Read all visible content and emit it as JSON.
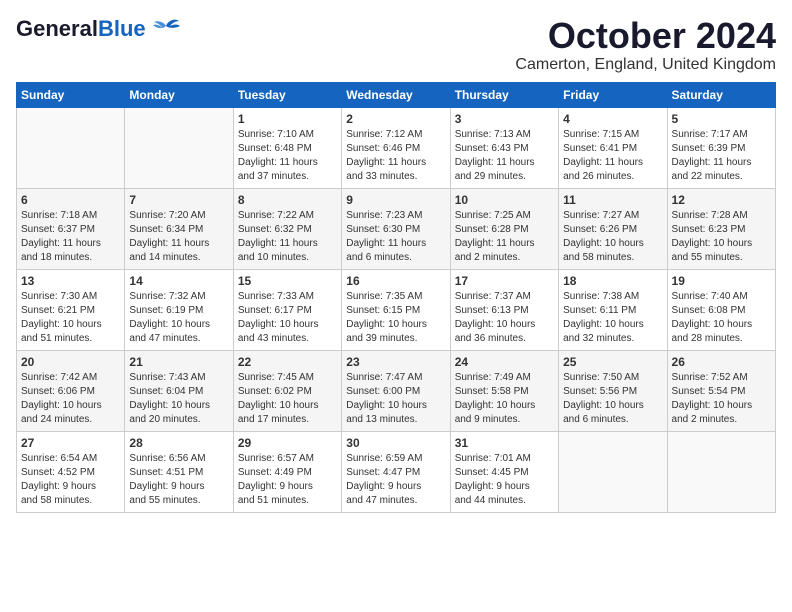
{
  "header": {
    "logo_general": "General",
    "logo_blue": "Blue",
    "month_title": "October 2024",
    "location": "Camerton, England, United Kingdom"
  },
  "weekdays": [
    "Sunday",
    "Monday",
    "Tuesday",
    "Wednesday",
    "Thursday",
    "Friday",
    "Saturday"
  ],
  "weeks": [
    [
      {
        "day": "",
        "info": ""
      },
      {
        "day": "",
        "info": ""
      },
      {
        "day": "1",
        "info": "Sunrise: 7:10 AM\nSunset: 6:48 PM\nDaylight: 11 hours\nand 37 minutes."
      },
      {
        "day": "2",
        "info": "Sunrise: 7:12 AM\nSunset: 6:46 PM\nDaylight: 11 hours\nand 33 minutes."
      },
      {
        "day": "3",
        "info": "Sunrise: 7:13 AM\nSunset: 6:43 PM\nDaylight: 11 hours\nand 29 minutes."
      },
      {
        "day": "4",
        "info": "Sunrise: 7:15 AM\nSunset: 6:41 PM\nDaylight: 11 hours\nand 26 minutes."
      },
      {
        "day": "5",
        "info": "Sunrise: 7:17 AM\nSunset: 6:39 PM\nDaylight: 11 hours\nand 22 minutes."
      }
    ],
    [
      {
        "day": "6",
        "info": "Sunrise: 7:18 AM\nSunset: 6:37 PM\nDaylight: 11 hours\nand 18 minutes."
      },
      {
        "day": "7",
        "info": "Sunrise: 7:20 AM\nSunset: 6:34 PM\nDaylight: 11 hours\nand 14 minutes."
      },
      {
        "day": "8",
        "info": "Sunrise: 7:22 AM\nSunset: 6:32 PM\nDaylight: 11 hours\nand 10 minutes."
      },
      {
        "day": "9",
        "info": "Sunrise: 7:23 AM\nSunset: 6:30 PM\nDaylight: 11 hours\nand 6 minutes."
      },
      {
        "day": "10",
        "info": "Sunrise: 7:25 AM\nSunset: 6:28 PM\nDaylight: 11 hours\nand 2 minutes."
      },
      {
        "day": "11",
        "info": "Sunrise: 7:27 AM\nSunset: 6:26 PM\nDaylight: 10 hours\nand 58 minutes."
      },
      {
        "day": "12",
        "info": "Sunrise: 7:28 AM\nSunset: 6:23 PM\nDaylight: 10 hours\nand 55 minutes."
      }
    ],
    [
      {
        "day": "13",
        "info": "Sunrise: 7:30 AM\nSunset: 6:21 PM\nDaylight: 10 hours\nand 51 minutes."
      },
      {
        "day": "14",
        "info": "Sunrise: 7:32 AM\nSunset: 6:19 PM\nDaylight: 10 hours\nand 47 minutes."
      },
      {
        "day": "15",
        "info": "Sunrise: 7:33 AM\nSunset: 6:17 PM\nDaylight: 10 hours\nand 43 minutes."
      },
      {
        "day": "16",
        "info": "Sunrise: 7:35 AM\nSunset: 6:15 PM\nDaylight: 10 hours\nand 39 minutes."
      },
      {
        "day": "17",
        "info": "Sunrise: 7:37 AM\nSunset: 6:13 PM\nDaylight: 10 hours\nand 36 minutes."
      },
      {
        "day": "18",
        "info": "Sunrise: 7:38 AM\nSunset: 6:11 PM\nDaylight: 10 hours\nand 32 minutes."
      },
      {
        "day": "19",
        "info": "Sunrise: 7:40 AM\nSunset: 6:08 PM\nDaylight: 10 hours\nand 28 minutes."
      }
    ],
    [
      {
        "day": "20",
        "info": "Sunrise: 7:42 AM\nSunset: 6:06 PM\nDaylight: 10 hours\nand 24 minutes."
      },
      {
        "day": "21",
        "info": "Sunrise: 7:43 AM\nSunset: 6:04 PM\nDaylight: 10 hours\nand 20 minutes."
      },
      {
        "day": "22",
        "info": "Sunrise: 7:45 AM\nSunset: 6:02 PM\nDaylight: 10 hours\nand 17 minutes."
      },
      {
        "day": "23",
        "info": "Sunrise: 7:47 AM\nSunset: 6:00 PM\nDaylight: 10 hours\nand 13 minutes."
      },
      {
        "day": "24",
        "info": "Sunrise: 7:49 AM\nSunset: 5:58 PM\nDaylight: 10 hours\nand 9 minutes."
      },
      {
        "day": "25",
        "info": "Sunrise: 7:50 AM\nSunset: 5:56 PM\nDaylight: 10 hours\nand 6 minutes."
      },
      {
        "day": "26",
        "info": "Sunrise: 7:52 AM\nSunset: 5:54 PM\nDaylight: 10 hours\nand 2 minutes."
      }
    ],
    [
      {
        "day": "27",
        "info": "Sunrise: 6:54 AM\nSunset: 4:52 PM\nDaylight: 9 hours\nand 58 minutes."
      },
      {
        "day": "28",
        "info": "Sunrise: 6:56 AM\nSunset: 4:51 PM\nDaylight: 9 hours\nand 55 minutes."
      },
      {
        "day": "29",
        "info": "Sunrise: 6:57 AM\nSunset: 4:49 PM\nDaylight: 9 hours\nand 51 minutes."
      },
      {
        "day": "30",
        "info": "Sunrise: 6:59 AM\nSunset: 4:47 PM\nDaylight: 9 hours\nand 47 minutes."
      },
      {
        "day": "31",
        "info": "Sunrise: 7:01 AM\nSunset: 4:45 PM\nDaylight: 9 hours\nand 44 minutes."
      },
      {
        "day": "",
        "info": ""
      },
      {
        "day": "",
        "info": ""
      }
    ]
  ]
}
